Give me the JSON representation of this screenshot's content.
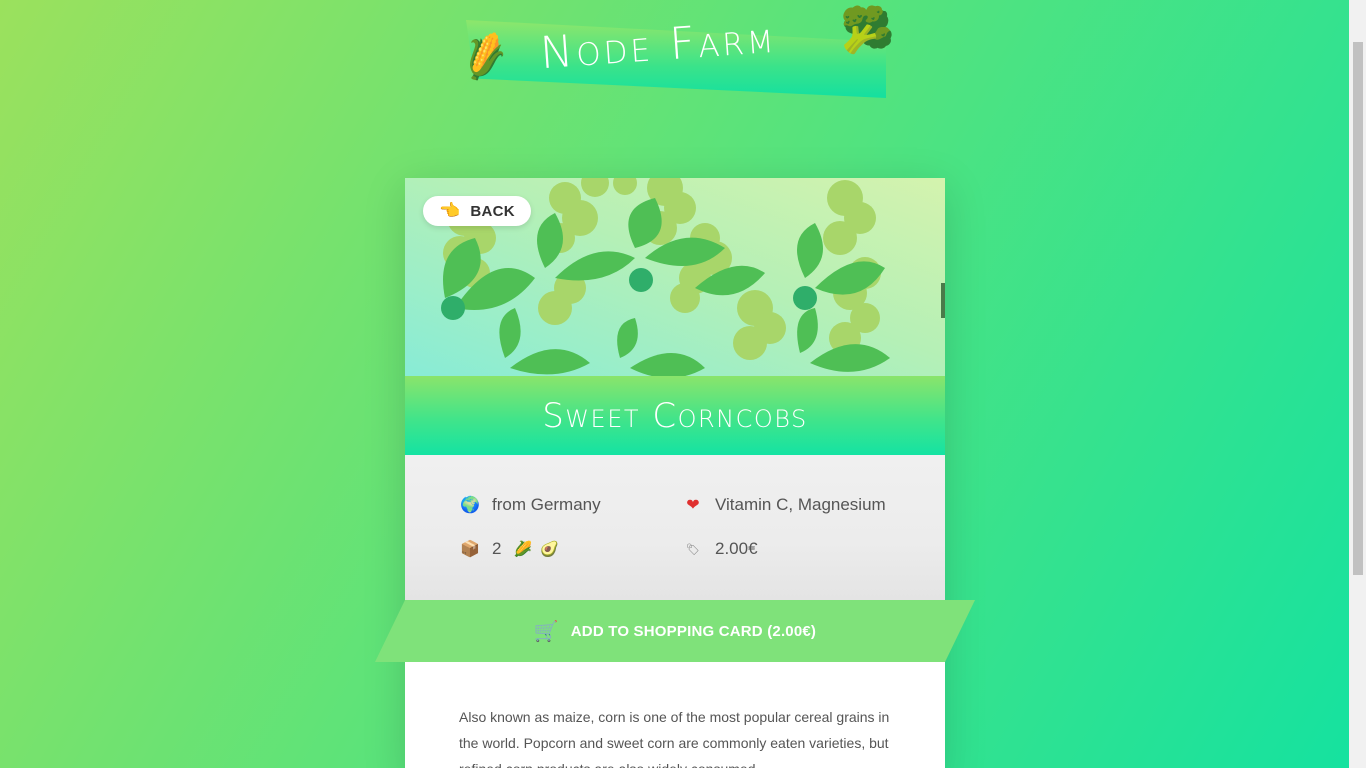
{
  "header": {
    "logo_text": "Node Farm",
    "logo_left_icon": "corn-icon",
    "logo_right_icon": "broccoli-icon"
  },
  "product": {
    "back_label": "BACK",
    "back_icon": "pointing-hand-icon",
    "title": "Sweet Corncobs",
    "origin": "from Germany",
    "origin_icon": "globe-icon",
    "nutrients": "Vitamin C, Magnesium",
    "nutrients_icon": "heart-icon",
    "quantity": "2",
    "quantity_icon": "package-icon",
    "quantity_emojis": "🌽 🥑",
    "price": "2.00€",
    "price_icon": "tag-icon",
    "add_to_cart_label": "ADD TO SHOPPING CARD (2.00€)",
    "cart_icon": "shopping-cart-icon",
    "description": "Also known as maize, corn is one of the most popular cereal grains in the world. Popcorn and sweet corn are commonly eaten varieties, but refined corn products are also widely consumed"
  },
  "colors": {
    "background_start": "#9be15d",
    "background_end": "#14e2a0",
    "button_green": "#7fe27a",
    "text_gray": "#555555"
  }
}
